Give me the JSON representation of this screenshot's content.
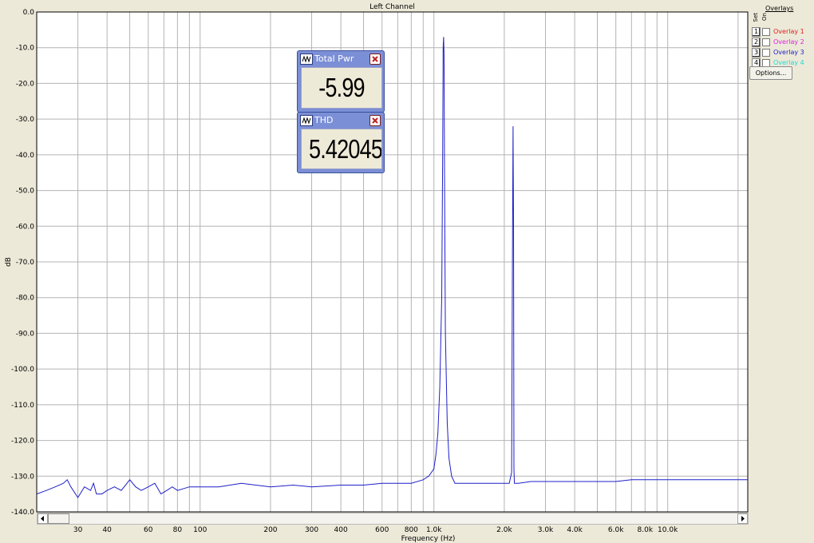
{
  "chart_title": "Left Channel",
  "colors": {
    "plot_background": "#ffffff",
    "grid": "#b4b4b4",
    "trace": "#1f1fc8",
    "window_background": "#ece9d8"
  },
  "chart_data": {
    "type": "line",
    "title": "Left Channel",
    "xlabel": "Frequency (Hz)",
    "ylabel": "dB",
    "x_scale": "log",
    "xlim": [
      20,
      22000
    ],
    "ylim": [
      -140,
      0
    ],
    "grid": true,
    "y_ticks": [
      "0.0",
      "-10.0",
      "-20.0",
      "-30.0",
      "-40.0",
      "-50.0",
      "-60.0",
      "-70.0",
      "-80.0",
      "-90.0",
      "-100.0",
      "-110.0",
      "-120.0",
      "-130.0",
      "-140.0"
    ],
    "x_ticks": [
      {
        "value": 30,
        "label": "30"
      },
      {
        "value": 40,
        "label": "40"
      },
      {
        "value": 60,
        "label": "60"
      },
      {
        "value": 80,
        "label": "80"
      },
      {
        "value": 100,
        "label": "100"
      },
      {
        "value": 200,
        "label": "200"
      },
      {
        "value": 300,
        "label": "300"
      },
      {
        "value": 400,
        "label": "400"
      },
      {
        "value": 600,
        "label": "600"
      },
      {
        "value": 800,
        "label": "800"
      },
      {
        "value": 1000,
        "label": "1.0k"
      },
      {
        "value": 2000,
        "label": "2.0k"
      },
      {
        "value": 3000,
        "label": "3.0k"
      },
      {
        "value": 4000,
        "label": "4.0k"
      },
      {
        "value": 6000,
        "label": "6.0k"
      },
      {
        "value": 8000,
        "label": "8.0k"
      },
      {
        "value": 10000,
        "label": "10.0k"
      }
    ],
    "series": [
      {
        "x": [
          20,
          22,
          24,
          26,
          27,
          28,
          30,
          32,
          34,
          35,
          36,
          38,
          40,
          43,
          46,
          50,
          53,
          56,
          60,
          64,
          68,
          72,
          76,
          80,
          90,
          100,
          120,
          150,
          200,
          250,
          300,
          400,
          500,
          600,
          700,
          800,
          900,
          950,
          1000,
          1020,
          1040,
          1060,
          1080,
          1090,
          1095,
          1100,
          1105,
          1110,
          1120,
          1140,
          1160,
          1190,
          1230,
          1300,
          1500,
          1800,
          2100,
          2150,
          2170,
          2180,
          2190,
          2200,
          2210,
          2230,
          2300,
          2600,
          3000,
          3500,
          4000,
          5000,
          6000,
          7000,
          8000,
          9000,
          10000,
          12000,
          15000,
          18000,
          22000
        ],
        "y": [
          -135,
          -134,
          -133,
          -132,
          -131,
          -133,
          -136,
          -133,
          -134,
          -132,
          -135,
          -135,
          -134,
          -133,
          -134,
          -131,
          -133,
          -134,
          -133,
          -132,
          -135,
          -134,
          -133,
          -134,
          -133,
          -133,
          -133,
          -132,
          -133,
          -132.5,
          -133,
          -132.5,
          -132.5,
          -132,
          -132,
          -132,
          -131,
          -130,
          -128,
          -124,
          -118,
          -105,
          -80,
          -40,
          -10,
          -7,
          -12,
          -45,
          -90,
          -115,
          -125,
          -130,
          -132,
          -132,
          -132,
          -132,
          -132,
          -129,
          -60,
          -32,
          -60,
          -128,
          -132,
          -132,
          -132,
          -131.5,
          -131.5,
          -131.5,
          -131.5,
          -131.5,
          -131.5,
          -131,
          -131,
          -131,
          -131,
          -131,
          -131,
          -131,
          -131
        ]
      }
    ]
  },
  "meters": [
    {
      "title": "Total Pwr",
      "value": "-5.99 dB"
    },
    {
      "title": "THD",
      "value": "5.42045 %"
    }
  ],
  "overlays_panel": {
    "title": "Overlays",
    "col_set": "Set",
    "col_on": "On",
    "items": [
      {
        "num": "1",
        "label": "Overlay 1",
        "color": "#e02020"
      },
      {
        "num": "2",
        "label": "Overlay 2",
        "color": "#e020e0"
      },
      {
        "num": "3",
        "label": "Overlay 3",
        "color": "#2020d0"
      },
      {
        "num": "4",
        "label": "Overlay 4",
        "color": "#20e0e0"
      }
    ],
    "options_label": "Options..."
  }
}
